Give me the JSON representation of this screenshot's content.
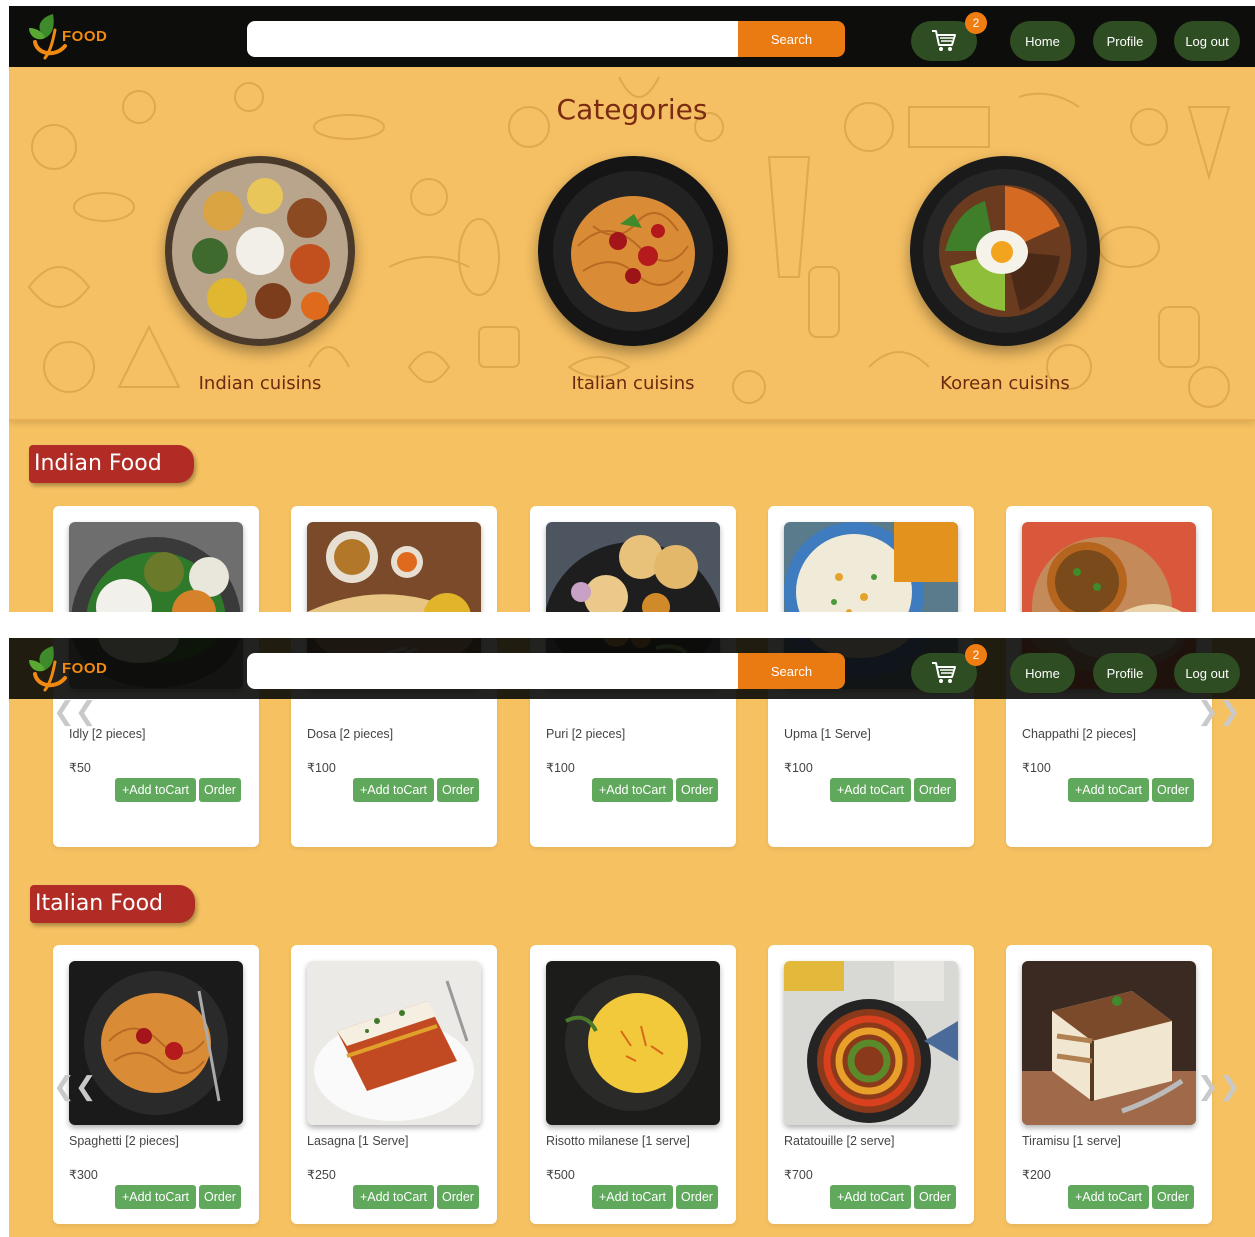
{
  "brand": {
    "logo_text": "FOOD"
  },
  "navbar": {
    "search_placeholder": "",
    "search_label": "Search",
    "cart_count": "2",
    "home_label": "Home",
    "profile_label": "Profile",
    "logout_label": "Log out"
  },
  "categories": {
    "title": "Categories",
    "items": [
      {
        "label": "Indian cuisins"
      },
      {
        "label": "Italian cuisins"
      },
      {
        "label": "Korean cuisins"
      }
    ]
  },
  "buttons": {
    "add_to_cart": "+Add toCart",
    "order": "Order"
  },
  "sections": [
    {
      "title": "Indian Food",
      "items": [
        {
          "name": "Idly [2 pieces]",
          "price": "₹50"
        },
        {
          "name": "Dosa [2 pieces]",
          "price": "₹100"
        },
        {
          "name": "Puri [2 pieces]",
          "price": "₹100"
        },
        {
          "name": "Upma [1 Serve]",
          "price": "₹100"
        },
        {
          "name": "Chappathi [2 pieces]",
          "price": "₹100"
        }
      ]
    },
    {
      "title": "Italian Food",
      "items": [
        {
          "name": "Spaghetti [2 pieces]",
          "price": "₹300"
        },
        {
          "name": "Lasagna [1 Serve]",
          "price": "₹250"
        },
        {
          "name": "Risotto milanese [1 serve]",
          "price": "₹500"
        },
        {
          "name": "Ratatouille [2 serve]",
          "price": "₹700"
        },
        {
          "name": "Tiramisu [1 serve]",
          "price": "₹200"
        }
      ]
    }
  ],
  "carousel": {
    "prev": "❮❮",
    "next": "❯❯"
  },
  "colors": {
    "accent": "#ea7a12",
    "nav_btn": "#2e4d22",
    "section_title": "#b22c26",
    "page_bg": "#f6c261",
    "add_button": "#5fa85c"
  }
}
